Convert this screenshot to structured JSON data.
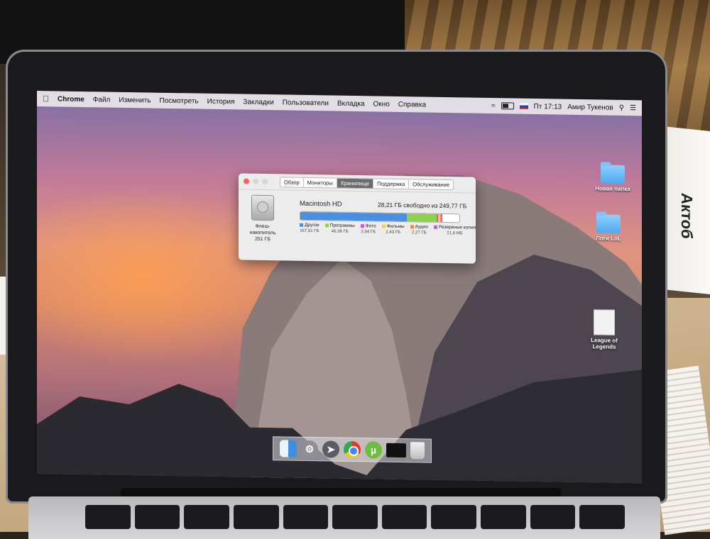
{
  "menubar": {
    "apple_icon": "",
    "app_name": "Chrome",
    "menus": [
      "Файл",
      "Изменить",
      "Посмотреть",
      "История",
      "Закладки",
      "Пользователи",
      "Вкладка",
      "Окно",
      "Справка"
    ],
    "clock": "Пт 17:13",
    "user": "Амир Тукенов",
    "status_icons": [
      "wifi-icon",
      "battery-icon",
      "flag-ru-icon",
      "search-icon",
      "list-icon"
    ]
  },
  "about_window": {
    "tabs": [
      "Обзор",
      "Мониторы",
      "Хранилище",
      "Поддержка",
      "Обслуживание"
    ],
    "active_tab": "Хранилище",
    "disk": {
      "type_label": "Флеш-накопитель",
      "size": "251 ГБ",
      "name": "Macintosh HD",
      "free_text": "28,21 ГБ свободно из 249,77 ГБ"
    },
    "storage_usage": [
      {
        "name": "Другое",
        "size": "167,51 ГБ",
        "gb": 167.51,
        "color": "#4a90e2"
      },
      {
        "name": "Программы",
        "size": "46,38 ГБ",
        "gb": 46.38,
        "color": "#8fd14f"
      },
      {
        "name": "Фото",
        "size": "2,94 ГБ",
        "gb": 2.94,
        "color": "#d455c8"
      },
      {
        "name": "Фильмы",
        "size": "2,43 ГБ",
        "gb": 2.43,
        "color": "#e8d34a"
      },
      {
        "name": "Аудио",
        "size": "2,27 ГБ",
        "gb": 2.27,
        "color": "#ef8a3c"
      },
      {
        "name": "Резервные копии",
        "size": "21,8 МБ",
        "gb": 0.02,
        "color": "#c060d8"
      }
    ],
    "total_gb": 249.77
  },
  "desktop_icons": [
    {
      "label": "Новая папка",
      "kind": "folder"
    },
    {
      "label": "Логи LoL",
      "kind": "folder"
    },
    {
      "label": "League of Legends",
      "kind": "document"
    }
  ],
  "dock": [
    "finder-icon",
    "system-preferences-icon",
    "launchpad-icon",
    "chrome-icon",
    "utorrent-icon",
    "terminal-icon",
    "trash-icon"
  ],
  "box_text": "Актоб"
}
